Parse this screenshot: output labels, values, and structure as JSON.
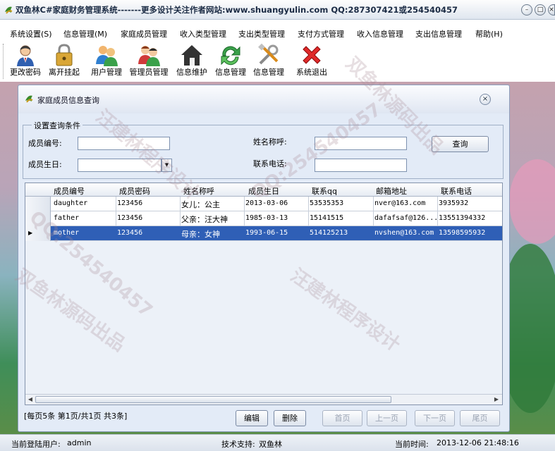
{
  "window": {
    "title": "双鱼林C#家庭财务管理系统-------更多设计关注作者网站:www.shuangyulin.com  QQ:287307421或254540457",
    "minimize_glyph": "–",
    "maximize_glyph": "□",
    "close_glyph": "×"
  },
  "menu": [
    "系统设置(S)",
    "信息管理(M)",
    "家庭成员管理",
    "收入类型管理",
    "支出类型管理",
    "支付方式管理",
    "收入信息管理",
    "支出信息管理",
    "帮助(H)"
  ],
  "toolbar": [
    {
      "label": "更改密码",
      "icon": "user-key-icon"
    },
    {
      "label": "离开挂起",
      "icon": "padlock-icon"
    },
    {
      "label": "用户管理",
      "icon": "users-icon"
    },
    {
      "label": "管理员管理",
      "icon": "admins-icon"
    },
    {
      "label": "信息维护",
      "icon": "home-icon"
    },
    {
      "label": "信息管理",
      "icon": "refresh-icon"
    },
    {
      "label": "信息管理",
      "icon": "tools-icon"
    },
    {
      "label": "系统退出",
      "icon": "exit-icon"
    }
  ],
  "dialog": {
    "title": "家庭成员信息查询",
    "close_glyph": "×",
    "query": {
      "legend": "设置查询条件",
      "member_no_label": "成员编号:",
      "name_label": "姓名称呼:",
      "birthday_label": "成员生日:",
      "phone_label": "联系电话:",
      "member_no_value": "",
      "name_value": "",
      "birthday_value": "",
      "phone_value": "",
      "dropdown_glyph": "▼",
      "search_button": "查询"
    },
    "grid": {
      "columns": [
        "成员编号",
        "成员密码",
        "姓名称呼",
        "成员生日",
        "联系qq",
        "邮箱地址",
        "联系电话"
      ],
      "rows": [
        [
          "daughter",
          "123456",
          "女儿：公主",
          "2013-03-06",
          "53535353",
          "nver@163.com",
          "3935932"
        ],
        [
          "father",
          "123456",
          "父亲：汪大神",
          "1985-03-13",
          "15141515",
          "dafafsaf@126...",
          "13551394332"
        ],
        [
          "mother",
          "123456",
          "母亲：女神",
          "1993-06-15",
          "514125213",
          "nvshen@163.com",
          "13598595932"
        ]
      ],
      "selected_row": 2,
      "row_pointer_glyph": "▶",
      "scroll_left_glyph": "◀",
      "scroll_right_glyph": "▶"
    },
    "pager": {
      "info": "[每页5条  第1页/共1页    共3条]",
      "edit": "编辑",
      "delete": "删除",
      "first": "首页",
      "prev": "上一页",
      "next": "下一页",
      "last": "尾页"
    }
  },
  "status": {
    "login_label": "当前登陆用户:",
    "login_user": "admin",
    "support_label": "技术支持:",
    "support_value": "双鱼林",
    "time_label": "当前时间:",
    "time_value": "2013-12-06 21:48:16"
  },
  "watermarks": [
    "QQ:254540457",
    "汪建林程序设计",
    "双鱼林源码出品",
    "QQ:254540457",
    "汪建林程序设计",
    "双鱼林源码出品"
  ]
}
